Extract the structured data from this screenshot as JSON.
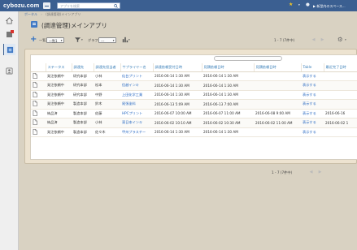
{
  "topbar": {
    "logo": "cybozu.com",
    "search_placeholder": "アプリを検索",
    "user_link": "▶ 新型内のスペース..."
  },
  "breadcrumb": {
    "items": [
      "ポータル",
      "(調達管理)メインアプリ"
    ]
  },
  "app": {
    "title": "(調達管理)メインアプリ"
  },
  "toolbar": {
    "view_label": "一覧",
    "view_selected": "一覧1",
    "graph_label": "グラフ",
    "graph_selected": "---",
    "pager_text": "1 - 7 (7件中)"
  },
  "table": {
    "columns": [
      "",
      "ステータス",
      "調達先",
      "調達先担当者",
      "サプライヤー名",
      "調達依頼受付日時",
      "見積依頼日時",
      "見積依頼日時",
      "Table",
      "最近完了日時"
    ],
    "rows": [
      [
        "",
        "発注依頼中",
        "研究本部",
        "小林",
        "仙台プリント",
        "2016-06-14 1:30 AM",
        "2016-06-14 1:30 AM",
        "",
        "表示する",
        ""
      ],
      [
        "",
        "発注依頼中",
        "研究本部",
        "松本",
        "信越インキ",
        "2016-06-14 1:30 AM",
        "2016-06-14 1:30 AM",
        "",
        "表示する",
        ""
      ],
      [
        "",
        "発注依頼中",
        "研究本部",
        "中野",
        "上田化学工業",
        "2016-06-14 1:30 AM",
        "2016-06-14 1:30 AM",
        "",
        "表示する",
        ""
      ],
      [
        "",
        "発注依頼中",
        "製造本部",
        "鈴木",
        "尾張塗料",
        "2016-06-13 5:09 AM",
        "2016-06-13 7:00 AM",
        "",
        "表示する",
        ""
      ],
      [
        "",
        "納品済",
        "製造本部",
        "佐藤",
        "HPCプリント",
        "2016-06-07 10:00 AM",
        "2016-06-07 11:00 AM",
        "2016-06-08 9:00 AM",
        "表示する",
        "2016-06-16"
      ],
      [
        "",
        "納品済",
        "製造本部",
        "小林",
        "東日本インキ",
        "2016-06-02 10:10 AM",
        "2016-06-02 10:30 AM",
        "2016-06-02 11:00 AM",
        "表示する",
        "2016-06-02 1"
      ],
      [
        "",
        "発注依頼中",
        "製造本部",
        "佐々木",
        "甲州ブラスチー",
        "2016-06-14 1:30 AM",
        "2016-06-14 1:30 AM",
        "",
        "表示する",
        ""
      ]
    ],
    "link_columns": [
      4,
      8
    ]
  },
  "colors": {
    "topbar": "#3b5f91",
    "accent": "#3f78c4",
    "link": "#2c6cc4",
    "card": "#ede3d0"
  },
  "icons": {
    "rail": [
      "home-icon",
      "notification-icon",
      "space-icon",
      "people-icon"
    ]
  }
}
